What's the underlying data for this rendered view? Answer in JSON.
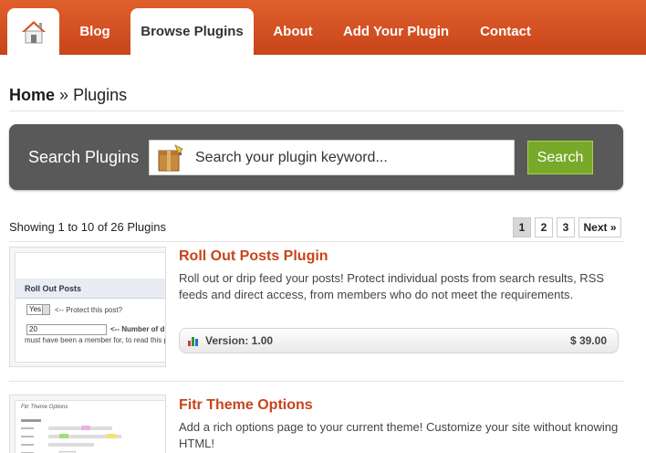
{
  "nav": {
    "home_icon": "house-icon",
    "items": [
      {
        "label": "Blog",
        "active": false
      },
      {
        "label": "Browse Plugins",
        "active": true
      },
      {
        "label": "About",
        "active": false
      },
      {
        "label": "Add Your Plugin",
        "active": false
      },
      {
        "label": "Contact",
        "active": false
      }
    ]
  },
  "breadcrumb": {
    "home": "Home",
    "separator": "»",
    "current": "Plugins"
  },
  "search": {
    "label": "Search Plugins",
    "placeholder": "Search your plugin keyword...",
    "value": "",
    "button": "Search",
    "icon": "plugin-box-icon"
  },
  "results": {
    "summary": "Showing 1 to 10 of 26 Plugins",
    "pages": [
      "1",
      "2",
      "3"
    ],
    "current_page": "1",
    "next": "Next »"
  },
  "plugins": [
    {
      "title": "Roll Out Posts Plugin",
      "description": "Roll out or drip feed your posts! Protect individual posts from search results, RSS feeds and direct access, from members who do not meet the requirements.",
      "version": "Version: 1.00",
      "price": "$ 39.00",
      "thumb": {
        "heading": "Roll Out Posts",
        "select_value": "Yes",
        "select_hint": "<-- Protect this post?",
        "number_value": "20",
        "number_hint": "<-- Number of d",
        "footer_text": "must have been a member for, to read this p"
      }
    },
    {
      "title": "Fitr Theme Options",
      "description": "Add a rich options page to your current theme! Customize your site without knowing HTML!",
      "thumb": {
        "heading": "Fitr Theme Options"
      }
    }
  ],
  "colors": {
    "brand": "#c8441a",
    "search_button": "#78a928",
    "search_panel": "#595959"
  }
}
